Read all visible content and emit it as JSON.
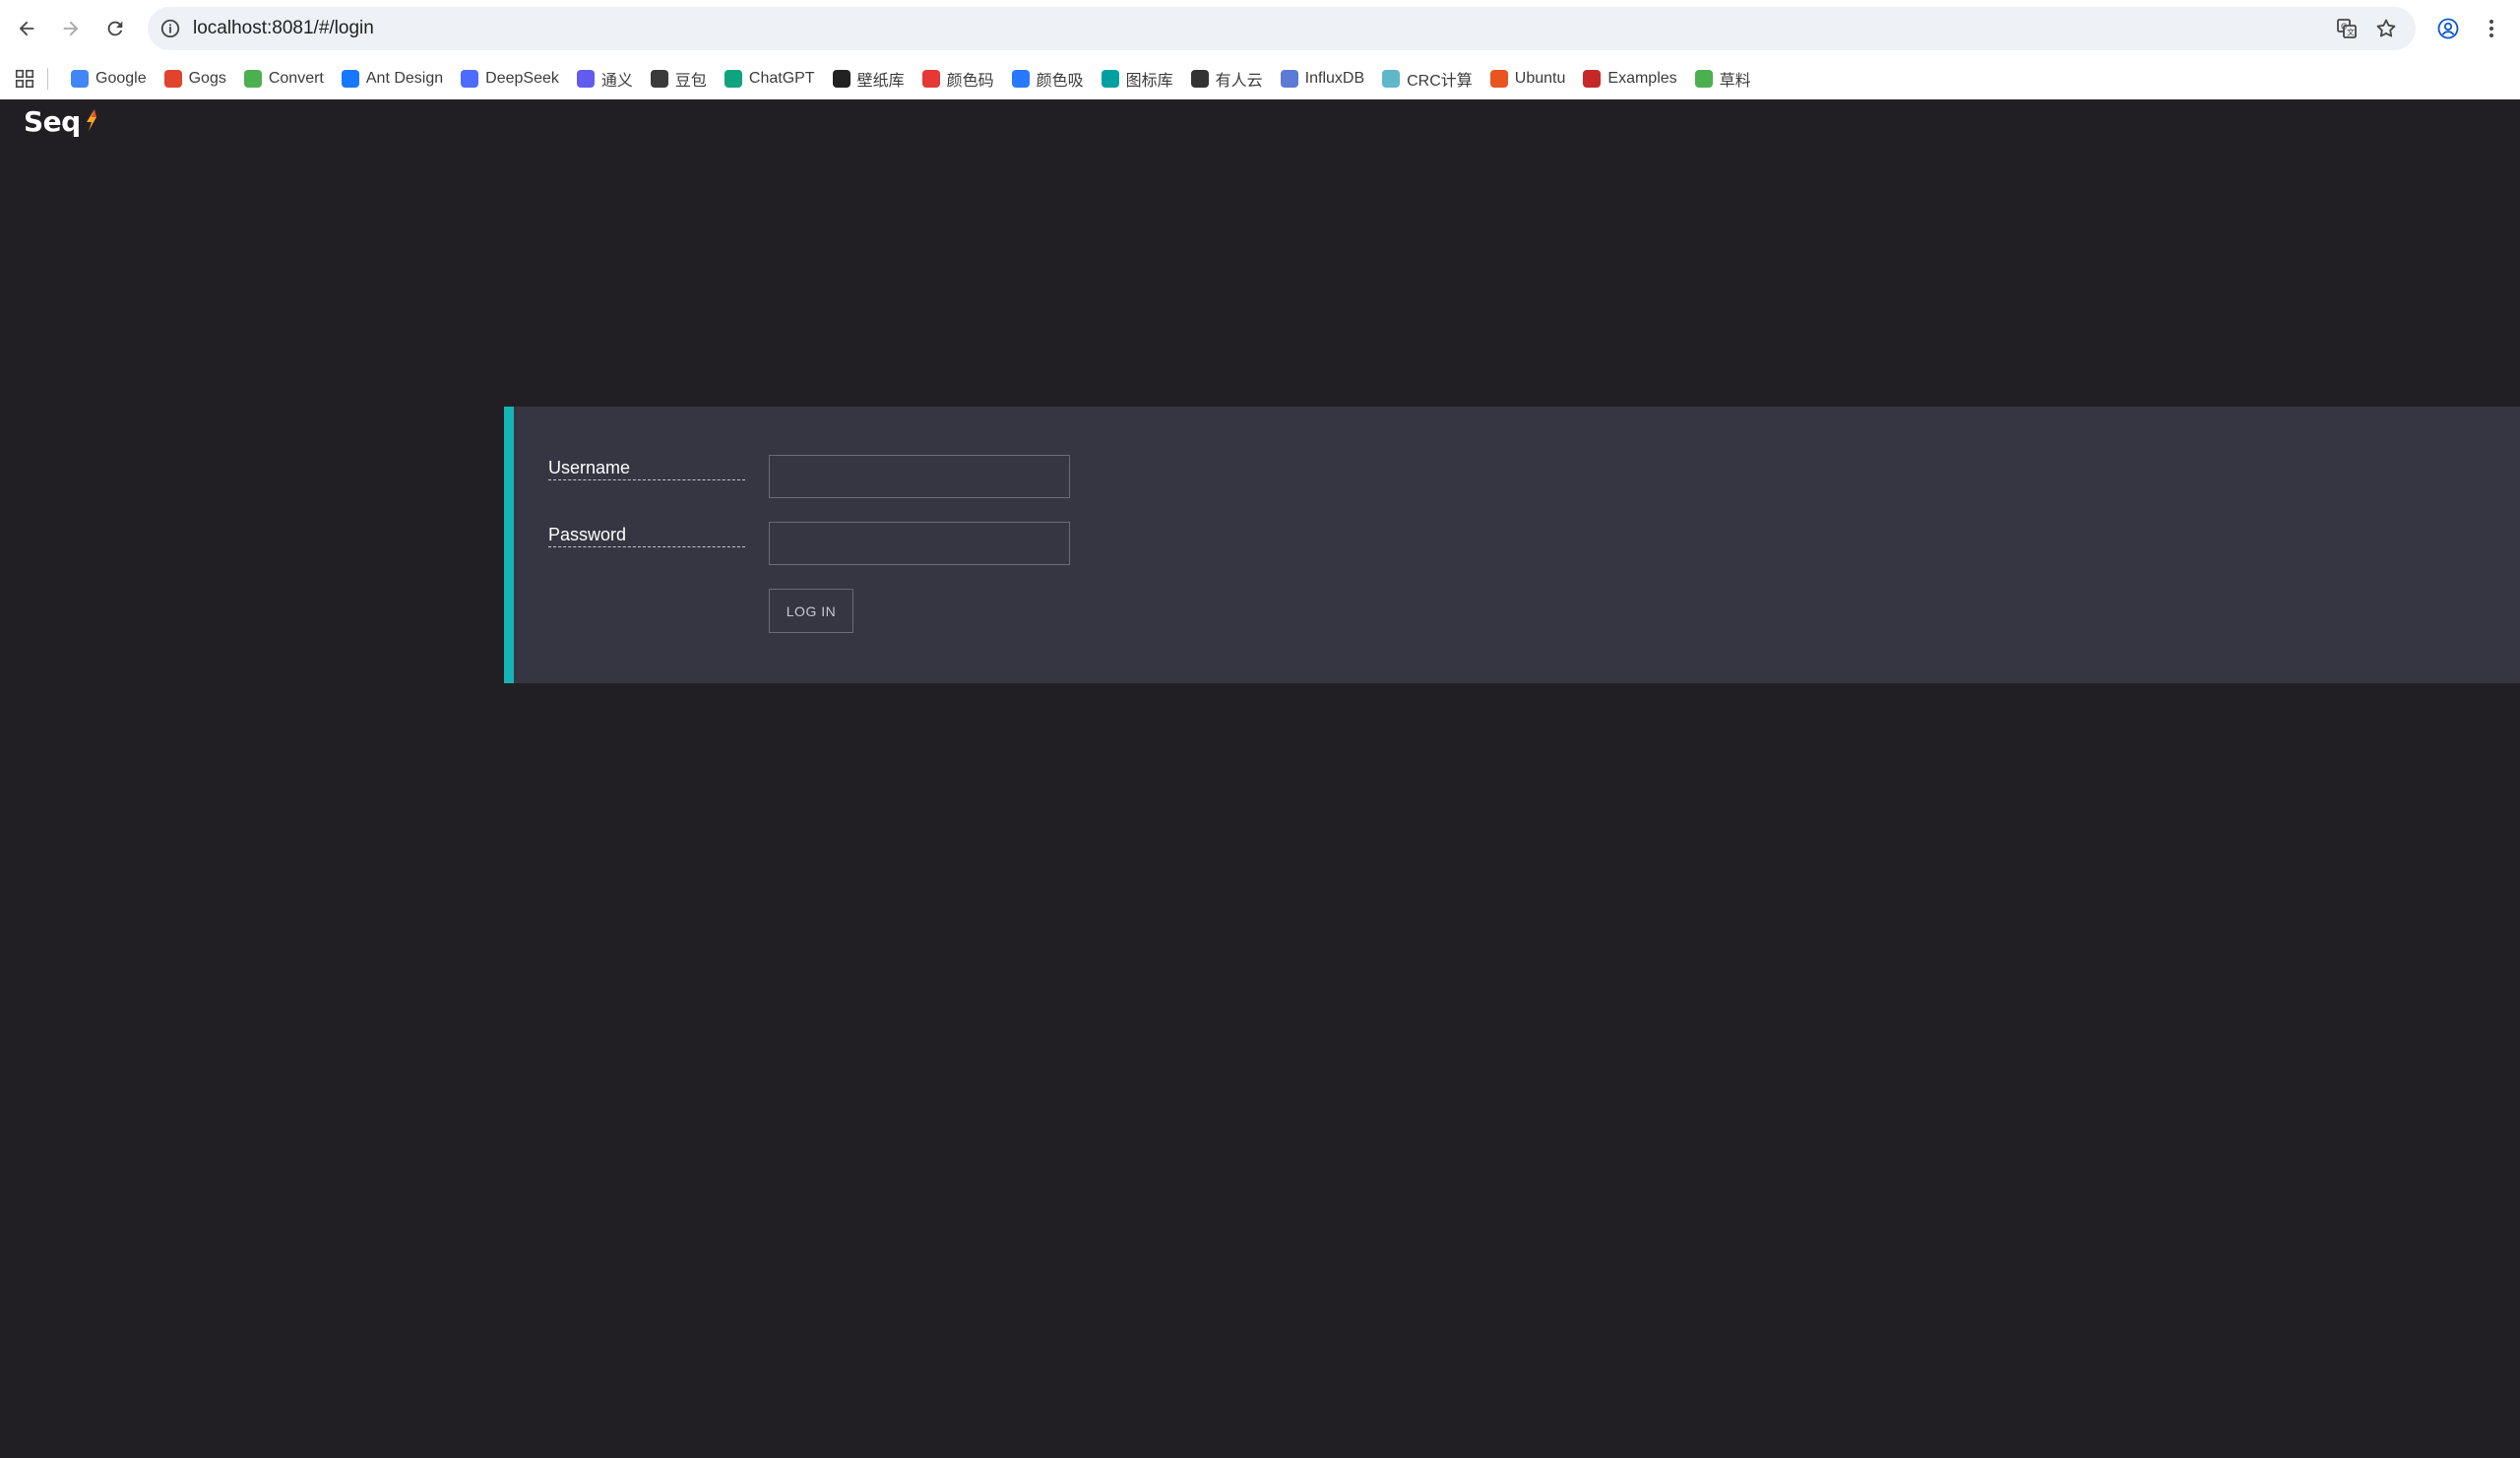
{
  "browser": {
    "url": "localhost:8081/#/login",
    "bookmarks": [
      {
        "label": "Google",
        "icon": "google-icon",
        "color": "#4285f4"
      },
      {
        "label": "Gogs",
        "icon": "gogs-icon",
        "color": "#e0442c"
      },
      {
        "label": "Convert",
        "icon": "convert-icon",
        "color": "#4caf50"
      },
      {
        "label": "Ant Design",
        "icon": "ant-design-icon",
        "color": "#1677ff"
      },
      {
        "label": "DeepSeek",
        "icon": "deepseek-icon",
        "color": "#4d6bfe"
      },
      {
        "label": "通义",
        "icon": "tongyi-icon",
        "color": "#615ced"
      },
      {
        "label": "豆包",
        "icon": "doubao-icon",
        "color": "#3a3a3a"
      },
      {
        "label": "ChatGPT",
        "icon": "chatgpt-icon",
        "color": "#10a37f"
      },
      {
        "label": "壁纸库",
        "icon": "wallpaper-icon",
        "color": "#222222"
      },
      {
        "label": "颜色码",
        "icon": "color-code-icon",
        "color": "#e53935"
      },
      {
        "label": "颜色吸",
        "icon": "color-picker-icon",
        "color": "#2979ff"
      },
      {
        "label": "图标库",
        "icon": "iconfont-icon",
        "color": "#00a0a0"
      },
      {
        "label": "有人云",
        "icon": "youren-cloud-icon",
        "color": "#333333"
      },
      {
        "label": "InfluxDB",
        "icon": "influxdb-icon",
        "color": "#5b7bd5"
      },
      {
        "label": "CRC计算",
        "icon": "crc-icon",
        "color": "#5fb8c9"
      },
      {
        "label": "Ubuntu",
        "icon": "ubuntu-icon",
        "color": "#e95420"
      },
      {
        "label": "Examples",
        "icon": "examples-icon",
        "color": "#c62828"
      },
      {
        "label": "草料",
        "icon": "qrcode-icon",
        "color": "#4caf50"
      }
    ]
  },
  "app": {
    "logo": "Seq",
    "accent_color": "#14b5b5",
    "panel_color": "#363542",
    "background_color": "#221f24"
  },
  "login": {
    "username_label": "Username",
    "username_value": "",
    "password_label": "Password",
    "password_value": "",
    "submit_label": "LOG IN"
  }
}
